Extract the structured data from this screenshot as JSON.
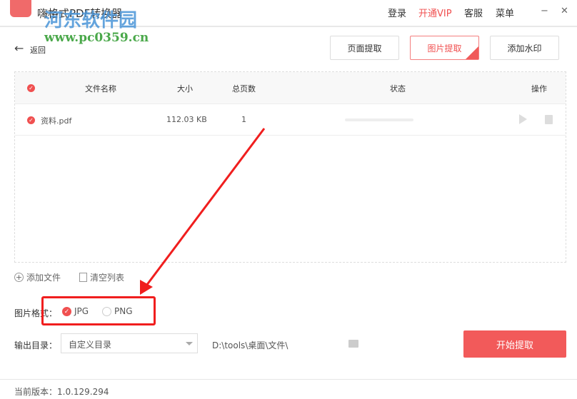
{
  "app": {
    "title": "嗨格式PDF转换器"
  },
  "menu": {
    "login": "登录",
    "vip": "开通VIP",
    "service": "客服",
    "menu": "菜单",
    "minimize": "−",
    "close": "✕"
  },
  "back": "返回",
  "tabs": [
    {
      "label": "页面提取",
      "active": false
    },
    {
      "label": "图片提取",
      "active": true
    },
    {
      "label": "添加水印",
      "active": false
    }
  ],
  "table": {
    "headers": {
      "name": "文件名称",
      "size": "大小",
      "pages": "总页数",
      "status": "状态",
      "actions": "操作"
    },
    "rows": [
      {
        "name": "资料.pdf",
        "size": "112.03 KB",
        "pages": "1",
        "progress": 0
      }
    ]
  },
  "toolbar": {
    "add": "添加文件",
    "clear": "清空列表"
  },
  "format": {
    "label": "图片格式：",
    "options": [
      {
        "label": "JPG",
        "selected": true
      },
      {
        "label": "PNG",
        "selected": false
      }
    ]
  },
  "output": {
    "label": "输出目录：",
    "selected": "自定义目录",
    "path": "D:\\tools\\桌面\\文件\\"
  },
  "start": "开始提取",
  "footer": {
    "version": "当前版本：1.0.129.294"
  },
  "watermark": {
    "name": "河东软件园",
    "url": "www.pc0359.cn"
  },
  "colors": {
    "accent": "#f05050",
    "annotation": "#f01e1e"
  }
}
